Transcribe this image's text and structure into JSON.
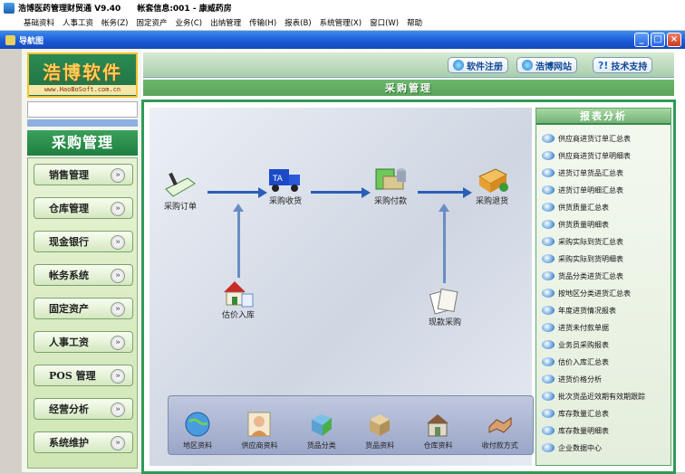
{
  "window": {
    "title": "浩博医药管理财贸通 V9.40",
    "account_info": "帐套信息:001 - 康威药房",
    "menu": [
      "基础资料",
      "人事工资",
      "帐务(Z)",
      "固定资产",
      "业务(C)",
      "出纳管理",
      "传输(H)",
      "报表(B)",
      "系统管理(X)",
      "窗口(W)",
      "帮助"
    ]
  },
  "navwindow": {
    "title": "导航图",
    "controls": [
      "_",
      "□",
      "×"
    ]
  },
  "logo": {
    "text": "浩博软件",
    "url": "www.HaoBoSoft.com.cn"
  },
  "left_nav": {
    "heading": "采购管理",
    "buttons": [
      "销售管理",
      "仓库管理",
      "现金银行",
      "帐务系统",
      "固定资产",
      "人事工资",
      "POS 管理",
      "经营分析",
      "系统维护"
    ]
  },
  "top_links": {
    "register": "软件注册",
    "website": "浩博网站",
    "support": "技术支持",
    "support_glyph": "?!"
  },
  "section_band": "采购管理",
  "flow": {
    "nodes": [
      "采购订单",
      "采购收货",
      "采购付款",
      "采购退货",
      "估价入库",
      "现款采购"
    ]
  },
  "bottom_tray": [
    "地区资料",
    "供应商资料",
    "货品分类",
    "货品资料",
    "仓库资料",
    "收付款方式"
  ],
  "report": {
    "heading": "报表分析",
    "items": [
      "供应商进货订单汇总表",
      "供应商进货订单明细表",
      "进货订单货品汇总表",
      "进货订单明细汇总表",
      "供货质量汇总表",
      "供货质量明细表",
      "采购实际到货汇总表",
      "采购实际到货明细表",
      "货品分类进货汇总表",
      "按地区分类进货汇总表",
      "年度进货情况报表",
      "进货未付款单据",
      "业务员采购报表",
      "估价入库汇总表",
      "进货价格分析",
      "批次货品近效期有效期跟踪",
      "库存数量汇总表",
      "库存数量明细表",
      "企业数据中心"
    ]
  },
  "colors": {
    "accent_green": "#2f9a58",
    "title_blue": "#1c5bd8",
    "link_blue": "#124a99"
  }
}
